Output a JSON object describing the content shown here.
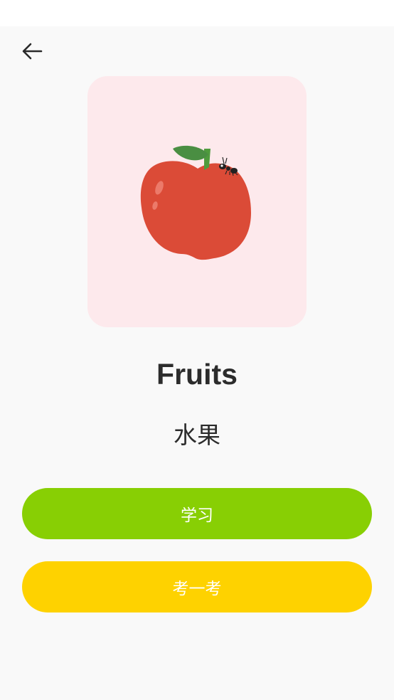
{
  "page": {
    "title": "Fruits",
    "subtitle": "水果"
  },
  "image": {
    "icon": "apple-icon",
    "background": "#fde9ec"
  },
  "buttons": {
    "learn_label": "学习",
    "learn_color": "#88cf04",
    "quiz_label": "考一考",
    "quiz_color": "#fed200"
  }
}
